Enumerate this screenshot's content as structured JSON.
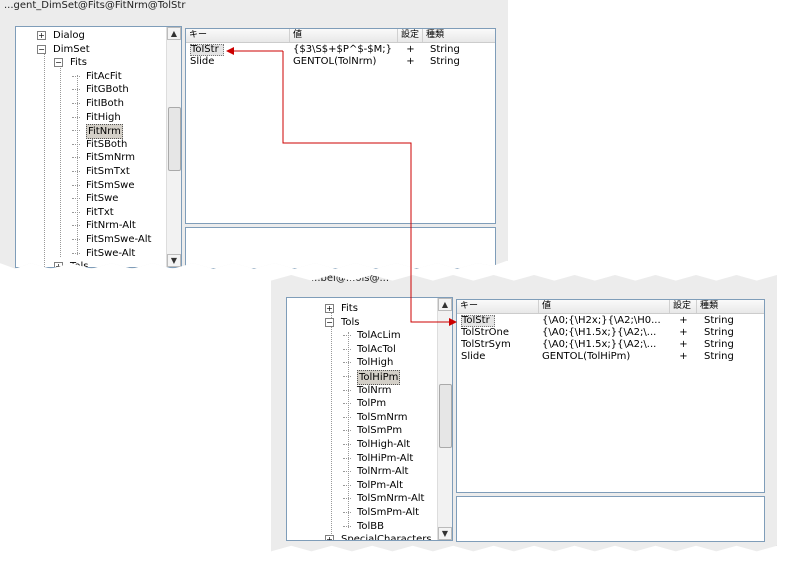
{
  "top_window": {
    "title": "...gent_DimSet@Fits@FitNrm@TolStr",
    "tree": [
      {
        "label": "Dialog",
        "expander": "+"
      },
      {
        "label": "DimSet",
        "expander": "−"
      },
      {
        "label": "Fits",
        "expander": "−"
      },
      {
        "label": "FitAcFit"
      },
      {
        "label": "FitGBoth"
      },
      {
        "label": "FitIBoth"
      },
      {
        "label": "FitHigh"
      },
      {
        "label": "FitNrm",
        "selected": true
      },
      {
        "label": "FitSBoth"
      },
      {
        "label": "FitSmNrm"
      },
      {
        "label": "FitSmTxt"
      },
      {
        "label": "FitSmSwe"
      },
      {
        "label": "FitSwe"
      },
      {
        "label": "FitTxt"
      },
      {
        "label": "FitNrm-Alt"
      },
      {
        "label": "FitSmSwe-Alt"
      },
      {
        "label": "FitSwe-Alt"
      },
      {
        "label": "Tols",
        "expander": "+"
      }
    ],
    "grid": {
      "headers": [
        "キー",
        "値",
        "設定",
        "種類"
      ],
      "rows": [
        {
          "key": "TolStr",
          "value": "{$3\\S$+$P^$-$M;}",
          "set": "+",
          "type": "String",
          "selected": true
        },
        {
          "key": "Slide",
          "value": "GENTOL(TolNrm)",
          "set": "+",
          "type": "String"
        }
      ]
    }
  },
  "bottom_window": {
    "title": "...bel@...ols@...",
    "tree": [
      {
        "label": "Fits",
        "expander": "+"
      },
      {
        "label": "Tols",
        "expander": "−"
      },
      {
        "label": "TolAcLim"
      },
      {
        "label": "TolAcTol"
      },
      {
        "label": "TolHigh"
      },
      {
        "label": "TolHiPm",
        "selected": true
      },
      {
        "label": "TolNrm"
      },
      {
        "label": "TolPm"
      },
      {
        "label": "TolSmNrm"
      },
      {
        "label": "TolSmPm"
      },
      {
        "label": "TolHigh-Alt"
      },
      {
        "label": "TolHiPm-Alt"
      },
      {
        "label": "TolNrm-Alt"
      },
      {
        "label": "TolPm-Alt"
      },
      {
        "label": "TolSmNrm-Alt"
      },
      {
        "label": "TolSmPm-Alt"
      },
      {
        "label": "TolBB"
      },
      {
        "label": "SpecialCharacters",
        "expander": "+"
      }
    ],
    "grid": {
      "headers": [
        "キー",
        "値",
        "設定",
        "種類"
      ],
      "rows": [
        {
          "key": "TolStr",
          "value": "{\\A0;{\\H2x;}{\\A2;\\H0...",
          "set": "+",
          "type": "String",
          "selected": true
        },
        {
          "key": "TolStrOne",
          "value": "{\\A0;{\\H1.5x;}{\\A2;\\...",
          "set": "+",
          "type": "String"
        },
        {
          "key": "TolStrSym",
          "value": "{\\A0;{\\H1.5x;}{\\A2;\\...",
          "set": "+",
          "type": "String"
        },
        {
          "key": "Slide",
          "value": "GENTOL(TolHiPm)",
          "set": "+",
          "type": "String"
        }
      ]
    }
  },
  "colors": {
    "arrow": "#cc0000",
    "panel_border": "#7f9db9",
    "window_bg": "#ececec"
  }
}
